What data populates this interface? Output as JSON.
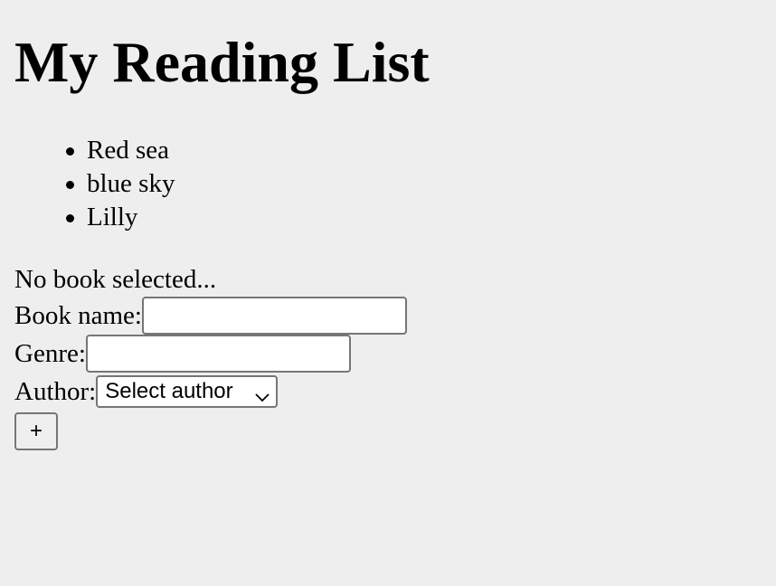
{
  "page": {
    "title": "My Reading List"
  },
  "books": [
    {
      "label": "Red sea"
    },
    {
      "label": "blue sky"
    },
    {
      "label": "Lilly"
    }
  ],
  "details": {
    "status": "No book selected..."
  },
  "form": {
    "book_name_label": "Book name:",
    "book_name_value": "",
    "genre_label": "Genre:",
    "genre_value": "",
    "author_label": "Author:",
    "author_selected": "Select author",
    "add_button_label": "+"
  }
}
